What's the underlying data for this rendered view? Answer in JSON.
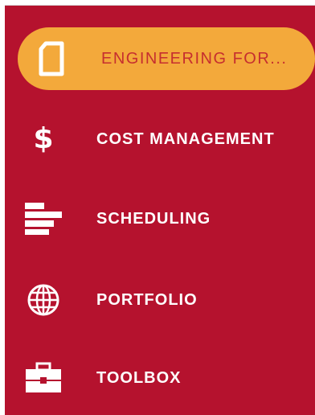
{
  "sidebar": {
    "active_color": "#f3a93b",
    "background_color": "#b5122e",
    "items": [
      {
        "label": "ENGINEERING FOR...",
        "icon": "document-icon",
        "active": true
      },
      {
        "label": "COST MANAGEMENT",
        "icon": "dollar-icon",
        "active": false
      },
      {
        "label": "SCHEDULING",
        "icon": "gantt-icon",
        "active": false
      },
      {
        "label": "PORTFOLIO",
        "icon": "globe-icon",
        "active": false
      },
      {
        "label": "TOOLBOX",
        "icon": "toolbox-icon",
        "active": false
      }
    ]
  }
}
